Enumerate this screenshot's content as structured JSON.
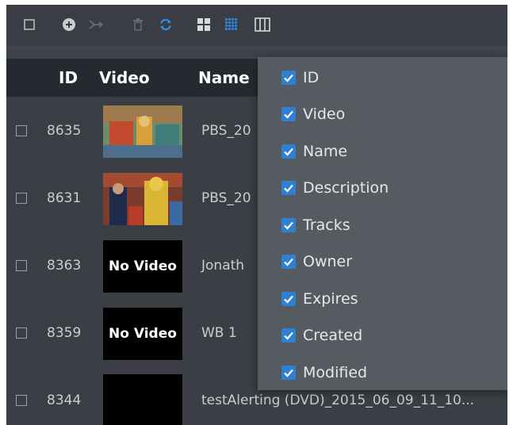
{
  "toolbar": {
    "icons": [
      "select-all-checkbox-icon",
      "add-circle-icon",
      "merge-icon",
      "trash-icon",
      "refresh-icon",
      "grid-large-icon",
      "grid-small-icon",
      "columns-icon"
    ]
  },
  "table": {
    "headers": {
      "id": "ID",
      "video": "Video",
      "name": "Name"
    },
    "rows": [
      {
        "id": "8635",
        "name": "PBS_20",
        "thumb": "image"
      },
      {
        "id": "8631",
        "name": "PBS_20",
        "thumb": "image"
      },
      {
        "id": "8363",
        "name": "Jonath",
        "thumb": "text",
        "thumb_text": "No Video"
      },
      {
        "id": "8359",
        "name": "WB 1",
        "thumb": "text",
        "thumb_text": "No Video"
      },
      {
        "id": "8344",
        "name": "testAlerting (DVD)_2015_06_09_11_10...",
        "thumb": "black"
      }
    ]
  },
  "column_menu": {
    "items": [
      {
        "label": "ID",
        "checked": true
      },
      {
        "label": "Video",
        "checked": true
      },
      {
        "label": "Name",
        "checked": true
      },
      {
        "label": "Description",
        "checked": true
      },
      {
        "label": "Tracks",
        "checked": true
      },
      {
        "label": "Owner",
        "checked": true
      },
      {
        "label": "Expires",
        "checked": true
      },
      {
        "label": "Created",
        "checked": true
      },
      {
        "label": "Modified",
        "checked": true
      }
    ]
  },
  "colors": {
    "accent": "#2f7fd3",
    "header_bg": "#262a30",
    "body_bg": "#3b3f45",
    "menu_bg": "#565a61"
  }
}
